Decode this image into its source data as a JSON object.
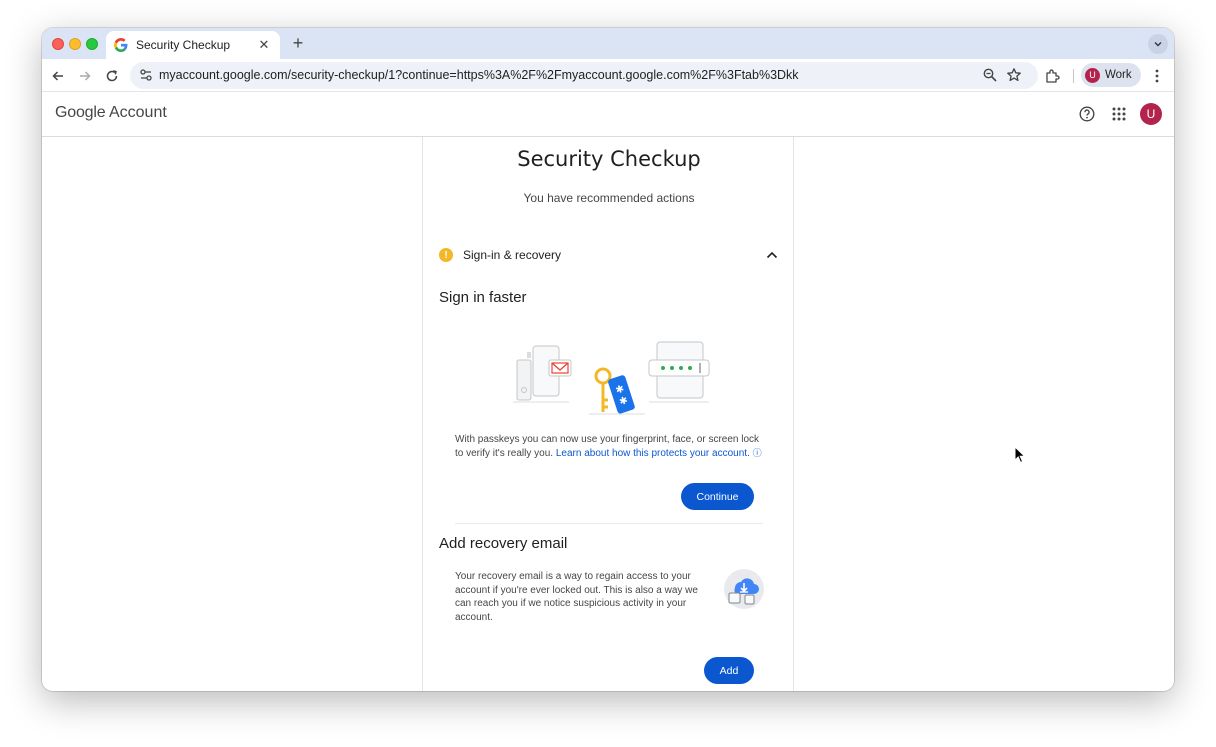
{
  "browser": {
    "tab": {
      "title": "Security Checkup",
      "favicon": "google-g-icon"
    },
    "url": "myaccount.google.com/security-checkup/1?continue=https%3A%2F%2Fmyaccount.google.com%2F%3Ftab%3Dkk",
    "profile": {
      "initial": "U",
      "label": "Work"
    }
  },
  "header": {
    "brand_google": "Google",
    "brand_account": "Account",
    "avatar_initial": "U"
  },
  "page": {
    "title": "Security Checkup",
    "subtitle": "You have recommended actions",
    "section": {
      "label": "Sign-in & recovery",
      "status": "warning"
    },
    "sign_in_faster": {
      "heading": "Sign in faster",
      "description": "With passkeys you can now use your fingerprint, face, or screen lock to verify it's really you. ",
      "link": "Learn about how this protects your account.",
      "button": "Continue"
    },
    "recovery_email": {
      "heading": "Add recovery email",
      "description": "Your recovery email is a way to regain access to your account if you're ever locked out. This is also a way we can reach you if we notice suspicious activity in your account.",
      "button": "Add"
    }
  },
  "colors": {
    "accent": "#0b57d0",
    "warning": "#f2b827",
    "avatar": "#b3244c",
    "tabstrip": "#dbe4f4"
  }
}
